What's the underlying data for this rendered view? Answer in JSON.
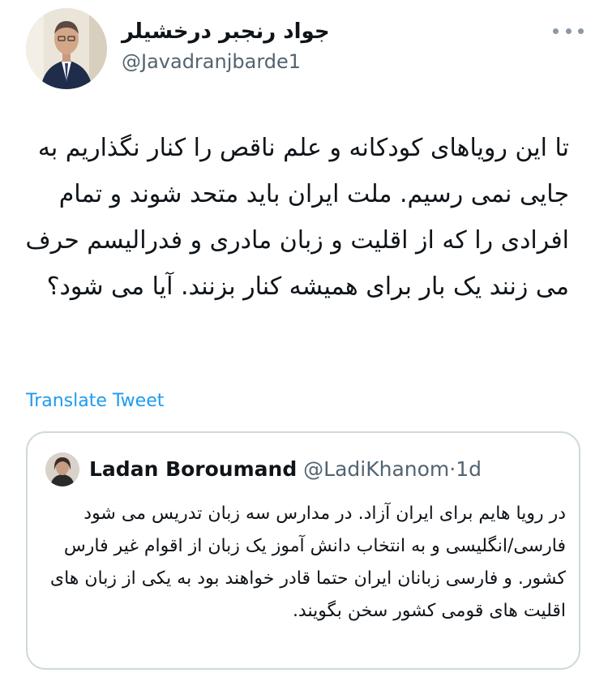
{
  "author": {
    "name": "جواد رنجبر درخشیلر",
    "handle": "@Javadranjbarde1",
    "avatar_icon": "avatar-photo"
  },
  "tweet": {
    "text": "تا این رویاهای کودکانه و علم ناقص را کنار نگذاریم به جایی نمی رسیم. ملت ایران باید متحد شوند و تمام افرادی را که از اقلیت و زبان مادری و فدرالیسم حرف می زنند یک بار برای همیشه کنار بزنند. آیا می شود؟",
    "translate_label": "Translate Tweet"
  },
  "quoted_tweet": {
    "name": "Ladan Boroumand",
    "handle": "@LadiKhanom",
    "separator": "·",
    "time": "1d",
    "text": "در رویا هایم برای ایران آزاد. در مدارس سه زبان تدریس می شود فارسی/انگلیسی و به انتخاب دانش آموز یک زبان از اقوام غیر فارس کشور. و فارسی زبانان ایران حتما قادر خواهند بود به یکی از زبان های اقلیت های قومی کشور سخن بگویند."
  },
  "colors": {
    "link": "#1d9bf0",
    "secondary_text": "#536471",
    "border": "#cfd9de"
  }
}
